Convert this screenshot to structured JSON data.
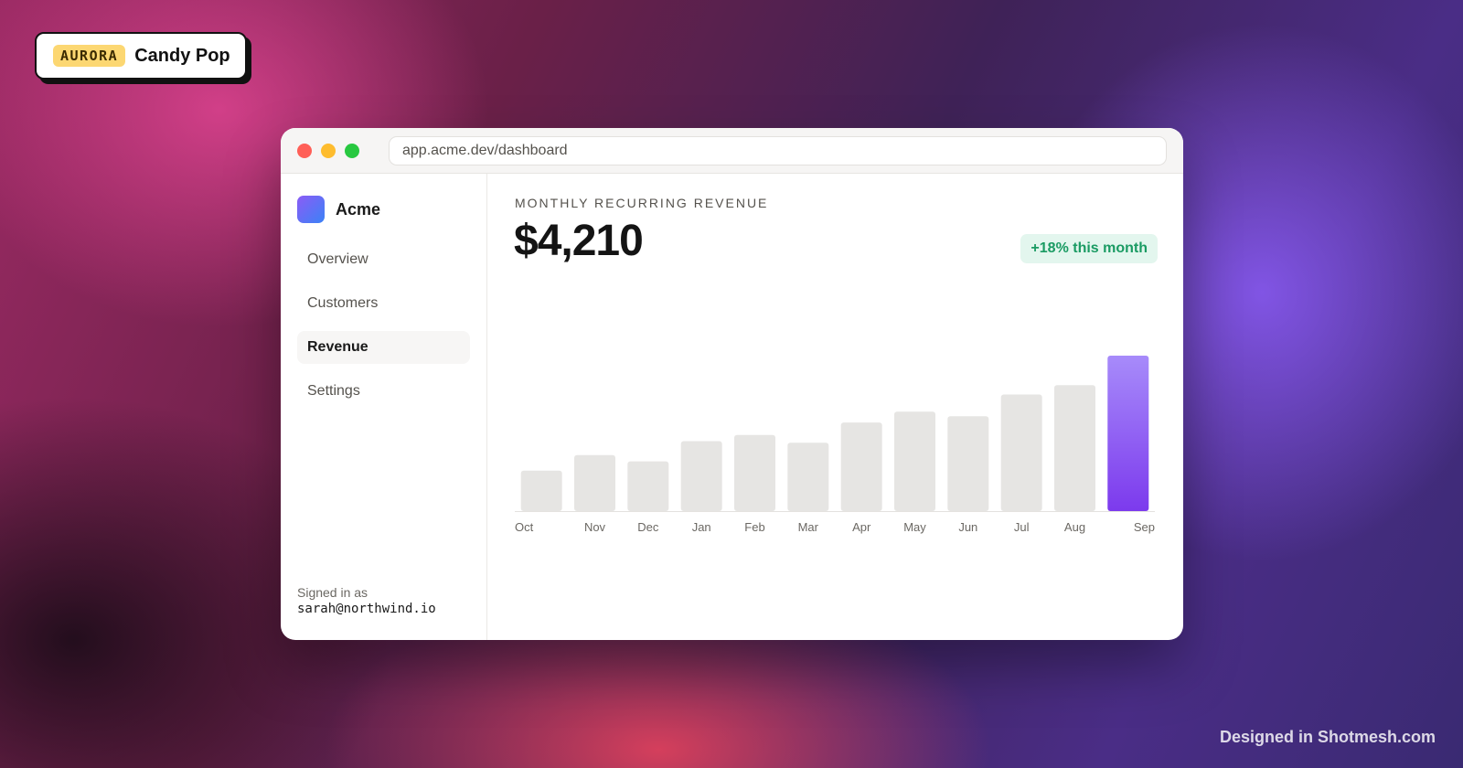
{
  "badge": {
    "tag": "AURORA",
    "name": "Candy Pop"
  },
  "browser": {
    "url": "app.acme.dev/dashboard"
  },
  "sidebar": {
    "brand": "Acme",
    "items": [
      {
        "label": "Overview",
        "active": false
      },
      {
        "label": "Customers",
        "active": false
      },
      {
        "label": "Revenue",
        "active": true
      },
      {
        "label": "Settings",
        "active": false
      }
    ],
    "signed_in_label": "Signed in as",
    "signed_in_email": "sarah@northwind.io"
  },
  "main": {
    "kpi_label": "MONTHLY RECURRING REVENUE",
    "kpi_value": "$4,210",
    "kpi_delta": "+18% this month"
  },
  "chart_data": {
    "type": "bar",
    "categories": [
      "Oct",
      "Nov",
      "Dec",
      "Jan",
      "Feb",
      "Mar",
      "Apr",
      "May",
      "Jun",
      "Jul",
      "Aug",
      "Sep"
    ],
    "values": [
      26,
      36,
      32,
      45,
      49,
      44,
      57,
      64,
      61,
      75,
      81,
      100
    ],
    "highlight_index": 11,
    "colors": {
      "bar": "#e6e5e3",
      "highlight_top": "#a78bfa",
      "highlight_bottom": "#7c3aed",
      "axis": "#e4e2df",
      "tick": "#6b6863"
    }
  },
  "footer": {
    "credit": "Designed in Shotmesh.com"
  }
}
